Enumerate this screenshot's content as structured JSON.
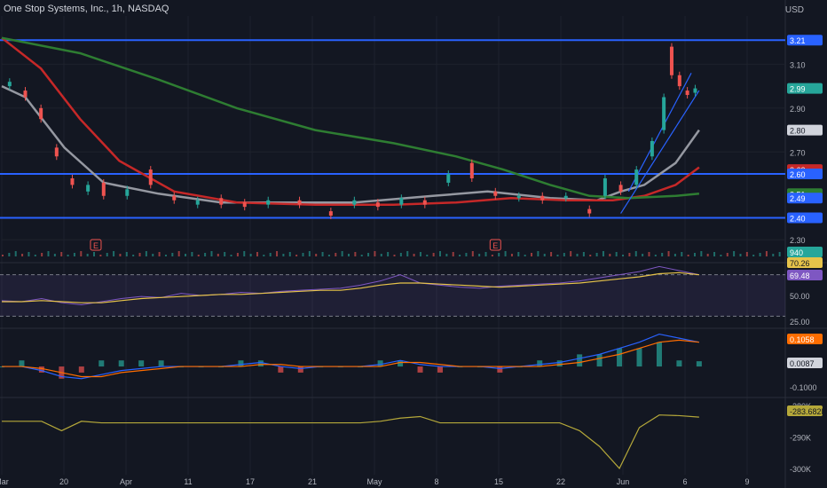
{
  "header": {
    "symbol_line": "One Stop Systems, Inc., 1h, NASDAQ",
    "currency": "USD"
  },
  "colors": {
    "bg": "#131722",
    "grid": "#1e222d",
    "axis_text": "#b2b5be",
    "up": "#26a69a",
    "down": "#ef5350",
    "level": "#2962ff",
    "ema_gray": "#9598a1",
    "ema_red": "#c62828",
    "ema_green": "#2e7d32",
    "rsi": "#7e57c2",
    "rsi_ma": "#e6c34a",
    "macd": "#2962ff",
    "signal": "#ff6d00",
    "obv": "#b5a83a",
    "channel": "#2962ff"
  },
  "chart_data": [
    {
      "type": "line",
      "name": "price",
      "x_ticks": [
        "Mar",
        "20",
        "Apr",
        "11",
        "17",
        "21",
        "May",
        "8",
        "15",
        "22",
        "Jun",
        "6",
        "9"
      ],
      "y_ticks": [
        "3.10",
        "2.90",
        "2.70",
        "2.30"
      ],
      "ylim": [
        2.22,
        3.32
      ],
      "horizontal_levels": [
        3.21,
        2.6,
        2.4
      ],
      "price_labels": [
        {
          "text": "3.21",
          "value": 3.21,
          "bg": "#2962ff",
          "fg": "#ffffff"
        },
        {
          "text": "2.99",
          "value": 2.99,
          "bg": "#26a69a",
          "fg": "#ffffff"
        },
        {
          "text": "2.80",
          "value": 2.8,
          "bg": "#d1d4dc",
          "fg": "#131722"
        },
        {
          "text": "2.62",
          "value": 2.62,
          "bg": "#c62828",
          "fg": "#ffffff"
        },
        {
          "text": "2.60",
          "value": 2.6,
          "bg": "#2962ff",
          "fg": "#ffffff"
        },
        {
          "text": "2.51",
          "value": 2.51,
          "bg": "#2e7d32",
          "fg": "#ffffff"
        },
        {
          "text": "2.49",
          "value": 2.49,
          "bg": "#2962ff",
          "fg": "#ffffff"
        },
        {
          "text": "2.40",
          "value": 2.4,
          "bg": "#2962ff",
          "fg": "#ffffff"
        }
      ],
      "series": [
        {
          "color_key": "ema_gray",
          "x": [
            0,
            0.03,
            0.08,
            0.13,
            0.2,
            0.28,
            0.36,
            0.45,
            0.55,
            0.62,
            0.7,
            0.76,
            0.79,
            0.82,
            0.86,
            0.89
          ],
          "y": [
            3.0,
            2.95,
            2.72,
            2.56,
            2.51,
            2.47,
            2.47,
            2.47,
            2.5,
            2.52,
            2.49,
            2.48,
            2.52,
            2.55,
            2.65,
            2.8
          ]
        },
        {
          "color_key": "ema_red",
          "x": [
            0,
            0.05,
            0.1,
            0.15,
            0.22,
            0.3,
            0.4,
            0.5,
            0.58,
            0.65,
            0.72,
            0.78,
            0.82,
            0.86,
            0.89
          ],
          "y": [
            3.22,
            3.08,
            2.85,
            2.66,
            2.52,
            2.47,
            2.46,
            2.46,
            2.47,
            2.49,
            2.48,
            2.48,
            2.5,
            2.55,
            2.63
          ]
        },
        {
          "color_key": "ema_green",
          "x": [
            0,
            0.1,
            0.2,
            0.3,
            0.4,
            0.5,
            0.58,
            0.64,
            0.7,
            0.75,
            0.8,
            0.86,
            0.89
          ],
          "y": [
            3.22,
            3.15,
            3.03,
            2.9,
            2.8,
            2.74,
            2.68,
            2.62,
            2.55,
            2.5,
            2.49,
            2.5,
            2.51
          ]
        }
      ],
      "candles": [
        {
          "x": 0.01,
          "o": 3.0,
          "c": 3.02
        },
        {
          "x": 0.03,
          "o": 2.98,
          "c": 2.95
        },
        {
          "x": 0.05,
          "o": 2.9,
          "c": 2.85
        },
        {
          "x": 0.07,
          "o": 2.72,
          "c": 2.68
        },
        {
          "x": 0.09,
          "o": 2.58,
          "c": 2.55
        },
        {
          "x": 0.11,
          "o": 2.52,
          "c": 2.55
        },
        {
          "x": 0.13,
          "o": 2.56,
          "c": 2.5
        },
        {
          "x": 0.16,
          "o": 2.5,
          "c": 2.53
        },
        {
          "x": 0.19,
          "o": 2.62,
          "c": 2.55
        },
        {
          "x": 0.22,
          "o": 2.5,
          "c": 2.48
        },
        {
          "x": 0.25,
          "o": 2.46,
          "c": 2.48
        },
        {
          "x": 0.28,
          "o": 2.49,
          "c": 2.46
        },
        {
          "x": 0.31,
          "o": 2.47,
          "c": 2.45
        },
        {
          "x": 0.34,
          "o": 2.46,
          "c": 2.48
        },
        {
          "x": 0.38,
          "o": 2.48,
          "c": 2.46
        },
        {
          "x": 0.42,
          "o": 2.43,
          "c": 2.41
        },
        {
          "x": 0.45,
          "o": 2.46,
          "c": 2.48
        },
        {
          "x": 0.48,
          "o": 2.47,
          "c": 2.45
        },
        {
          "x": 0.51,
          "o": 2.46,
          "c": 2.49
        },
        {
          "x": 0.54,
          "o": 2.48,
          "c": 2.46
        },
        {
          "x": 0.57,
          "o": 2.56,
          "c": 2.6
        },
        {
          "x": 0.6,
          "o": 2.65,
          "c": 2.58
        },
        {
          "x": 0.63,
          "o": 2.52,
          "c": 2.5
        },
        {
          "x": 0.66,
          "o": 2.49,
          "c": 2.5
        },
        {
          "x": 0.69,
          "o": 2.5,
          "c": 2.48
        },
        {
          "x": 0.72,
          "o": 2.49,
          "c": 2.5
        },
        {
          "x": 0.75,
          "o": 2.44,
          "c": 2.42
        },
        {
          "x": 0.77,
          "o": 2.5,
          "c": 2.58
        },
        {
          "x": 0.79,
          "o": 2.55,
          "c": 2.52
        },
        {
          "x": 0.81,
          "o": 2.55,
          "c": 2.62
        },
        {
          "x": 0.83,
          "o": 2.68,
          "c": 2.75
        },
        {
          "x": 0.845,
          "o": 2.8,
          "c": 2.95
        },
        {
          "x": 0.855,
          "o": 3.18,
          "c": 3.05
        },
        {
          "x": 0.865,
          "o": 3.05,
          "c": 3.0
        },
        {
          "x": 0.875,
          "o": 2.98,
          "c": 2.96
        },
        {
          "x": 0.885,
          "o": 2.97,
          "c": 2.99
        }
      ],
      "volume_label": "940",
      "earnings_markers": [
        0.12,
        0.63
      ]
    },
    {
      "type": "line",
      "name": "rsi",
      "ylim": [
        20,
        80
      ],
      "y_ticks": [
        "50.00",
        "25.00"
      ],
      "value_labels": [
        {
          "text": "70.26",
          "bg": "#e6c34a",
          "fg": "#131722"
        },
        {
          "text": "69.48",
          "bg": "#7e57c2",
          "fg": "#ffffff"
        }
      ],
      "rsi": [
        45,
        44,
        47,
        43,
        41,
        44,
        47,
        49,
        48,
        52,
        50,
        51,
        53,
        52,
        54,
        55,
        56,
        57,
        60,
        64,
        70,
        62,
        60,
        58,
        57,
        59,
        60,
        61,
        62,
        64,
        67,
        70,
        73,
        78,
        74,
        70
      ],
      "rsi_ma": [
        44,
        44,
        45,
        44,
        43,
        43,
        45,
        47,
        48,
        49,
        50,
        51,
        51,
        52,
        53,
        54,
        55,
        55,
        57,
        60,
        62,
        62,
        61,
        60,
        59,
        58,
        59,
        60,
        61,
        62,
        64,
        66,
        68,
        71,
        72,
        70
      ]
    },
    {
      "type": "bar",
      "name": "macd",
      "ylim": [
        -0.14,
        0.18
      ],
      "y_ticks": [
        "-0.1000"
      ],
      "value_labels": [
        {
          "text": "0.1058",
          "bg": "#ff6d00",
          "fg": "#ffffff"
        },
        {
          "text": "0.0087",
          "bg": "#d1d4dc",
          "fg": "#131722"
        }
      ],
      "macd": [
        0.0,
        0.0,
        -0.02,
        -0.05,
        -0.06,
        -0.04,
        -0.02,
        -0.01,
        0.0,
        0.0,
        0.0,
        0.0,
        0.01,
        0.02,
        0.0,
        -0.01,
        0.0,
        0.0,
        0.0,
        0.01,
        0.03,
        0.01,
        0.0,
        0.0,
        0.0,
        -0.01,
        0.0,
        0.01,
        0.02,
        0.04,
        0.06,
        0.09,
        0.12,
        0.16,
        0.14,
        0.12
      ],
      "signal": [
        0.0,
        0.0,
        -0.01,
        -0.03,
        -0.05,
        -0.05,
        -0.03,
        -0.02,
        -0.01,
        0.0,
        0.0,
        0.0,
        0.0,
        0.01,
        0.01,
        0.0,
        0.0,
        0.0,
        0.0,
        0.0,
        0.02,
        0.02,
        0.01,
        0.0,
        0.0,
        0.0,
        0.0,
        0.0,
        0.01,
        0.02,
        0.04,
        0.06,
        0.09,
        0.12,
        0.13,
        0.12
      ],
      "hist": [
        0.0,
        0.01,
        -0.01,
        -0.02,
        -0.01,
        0.01,
        0.01,
        0.01,
        0.01,
        0.0,
        0.0,
        0.0,
        0.01,
        0.01,
        -0.01,
        -0.01,
        0.0,
        0.0,
        0.0,
        0.01,
        0.01,
        -0.01,
        -0.01,
        0.0,
        0.0,
        -0.01,
        0.0,
        0.01,
        0.01,
        0.02,
        0.02,
        0.03,
        0.03,
        0.04,
        0.01,
        0.0087
      ]
    },
    {
      "type": "line",
      "name": "obv",
      "ylim": [
        -302000,
        -278000
      ],
      "y_ticks": [
        "-280K",
        "-290K",
        "-300K"
      ],
      "value_labels": [
        {
          "text": "-283.682K",
          "bg": "#b5a83a",
          "fg": "#131722"
        }
      ],
      "obv": [
        -285000,
        -285000,
        -285000,
        -288000,
        -285000,
        -285500,
        -285500,
        -285500,
        -285500,
        -285500,
        -285500,
        -285500,
        -285500,
        -285500,
        -285500,
        -285500,
        -285500,
        -285500,
        -285500,
        -285000,
        -284000,
        -283500,
        -285500,
        -285500,
        -285500,
        -285500,
        -285500,
        -285500,
        -285500,
        -288000,
        -293000,
        -300000,
        -287000,
        -283000,
        -283200,
        -283682
      ]
    }
  ]
}
